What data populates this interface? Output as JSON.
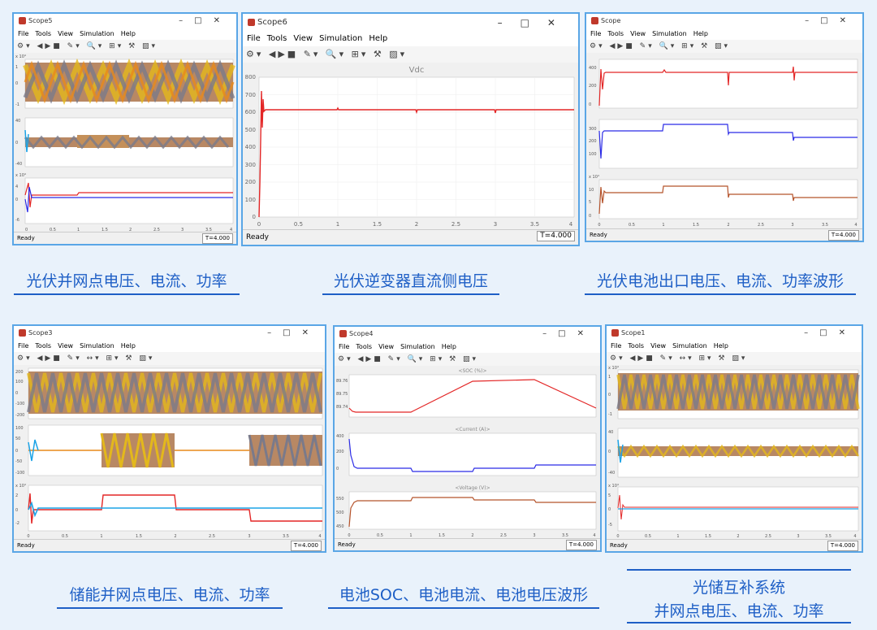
{
  "menu": [
    "File",
    "Tools",
    "View",
    "Simulation",
    "Help"
  ],
  "status": {
    "ready": "Ready",
    "time": "T=4.000"
  },
  "windows": [
    {
      "title": "Scope5",
      "panels": [
        {
          "ylabels": [
            "x 10⁴",
            "1",
            "0.5",
            "0",
            "-0.5",
            "-1"
          ],
          "series": "noise"
        },
        {
          "ylabels": [
            "40",
            "20",
            "0",
            "-20",
            "-40"
          ],
          "series": "band"
        },
        {
          "ylabels": [
            "x 10⁴",
            "4",
            "2",
            "0",
            "-2",
            "-4",
            "-6"
          ],
          "series": "twolines"
        }
      ],
      "xticks": [
        "0",
        "0.5",
        "1",
        "1.5",
        "2",
        "2.5",
        "3",
        "3.5",
        "4"
      ]
    },
    {
      "title": "Scope6",
      "plot_title": "Vdc",
      "yticks": [
        "800",
        "700",
        "600",
        "500",
        "400",
        "300",
        "200",
        "100",
        "0"
      ],
      "xticks": [
        "0",
        "0.5",
        "1",
        "1.5",
        "2",
        "2.5",
        "3",
        "3.5",
        "4"
      ]
    },
    {
      "title": "Scope",
      "panels": [
        {
          "ylabels": [
            "400",
            "200",
            "0"
          ]
        },
        {
          "ylabels": [
            "300",
            "200",
            "100"
          ]
        },
        {
          "ylabels": [
            "x 10⁴",
            "10",
            "5",
            "0"
          ]
        }
      ],
      "xticks": [
        "0",
        "0.5",
        "1",
        "1.5",
        "2",
        "2.5",
        "3",
        "3.5",
        "4"
      ]
    },
    {
      "title": "Scope3",
      "panels": [
        {
          "ylabels": [
            "200",
            "100",
            "0",
            "-100",
            "-200"
          ]
        },
        {
          "ylabels": [
            "100",
            "50",
            "0",
            "-50",
            "-100"
          ]
        },
        {
          "ylabels": [
            "x 10⁴",
            "2",
            "0",
            "-2"
          ]
        }
      ],
      "xticks": [
        "0",
        "0.5",
        "1",
        "1.5",
        "2",
        "2.5",
        "3",
        "3.5",
        "4"
      ]
    },
    {
      "title": "Scope4",
      "panels": [
        {
          "subtitle": "<SOC (%)>",
          "ylabels": [
            "89.76",
            "89.75",
            "89.74"
          ]
        },
        {
          "subtitle": "<Current (A)>",
          "ylabels": [
            "400",
            "200",
            "0"
          ]
        },
        {
          "subtitle": "<Voltage (V)>",
          "ylabels": [
            "550",
            "500",
            "450"
          ]
        }
      ],
      "xticks": [
        "0",
        "0.5",
        "1",
        "1.5",
        "2",
        "2.5",
        "3",
        "3.5",
        "4"
      ]
    },
    {
      "title": "Scope1",
      "panels": [
        {
          "ylabels": [
            "x 10⁴",
            "1",
            "0.5",
            "0",
            "-0.5",
            "-1"
          ]
        },
        {
          "ylabels": [
            "40",
            "20",
            "0",
            "-20",
            "-40"
          ]
        },
        {
          "ylabels": [
            "x 10⁴",
            "5",
            "0",
            "-5"
          ]
        }
      ],
      "xticks": [
        "0",
        "0.5",
        "1",
        "1.5",
        "2",
        "2.5",
        "3",
        "3.5",
        "4"
      ]
    }
  ],
  "captions": {
    "c1": "光伏并网点电压、电流、功率",
    "c2": "光伏逆变器直流侧电压",
    "c3": "光伏电池出口电压、电流、功率波形",
    "c4": "储能并网点电压、电流、功率",
    "c5": "电池SOC、电池电流、电池电压波形",
    "c6a": "光储互补系统",
    "c6b": "并网点电压、电流、功率"
  },
  "colors": {
    "accent": "#1e5fc6",
    "border": "#5aa6e6",
    "red": "#e32626",
    "blue": "#2b2be6",
    "brown": "#b5532b",
    "orange": "#e88a1a",
    "yellow": "#e3b81c",
    "gray": "#7a7a8a",
    "cyan": "#1ca3e6"
  }
}
